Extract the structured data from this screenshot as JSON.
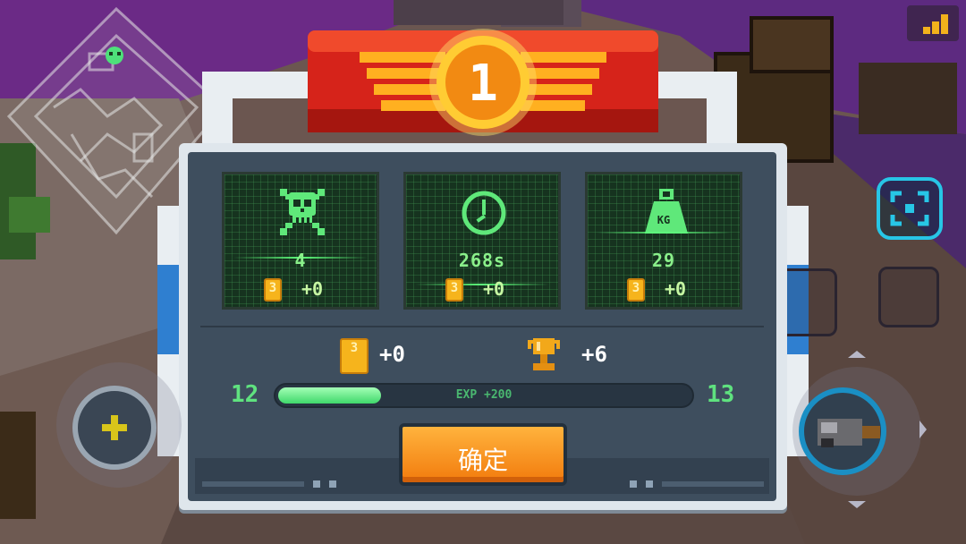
{
  "rank": {
    "value": "1"
  },
  "stats": [
    {
      "icon": "skull-icon",
      "value": "4",
      "coins": "+0"
    },
    {
      "icon": "clock-icon",
      "value": "268s",
      "coins": "+0"
    },
    {
      "icon": "weight-icon",
      "icon_text": "KG",
      "value": "29",
      "coins": "+0"
    }
  ],
  "rewards": {
    "coins": "+0",
    "trophy": "+6"
  },
  "exp": {
    "level_current": "12",
    "level_next": "13",
    "label": "EXP +200",
    "progress": 0.25
  },
  "confirm_button": {
    "label": "确定"
  },
  "colors": {
    "accent_green": "#5fe27f",
    "coin_gold": "#f6b41c",
    "button_orange": "#f27b0d",
    "banner_red": "#e02a1e"
  }
}
